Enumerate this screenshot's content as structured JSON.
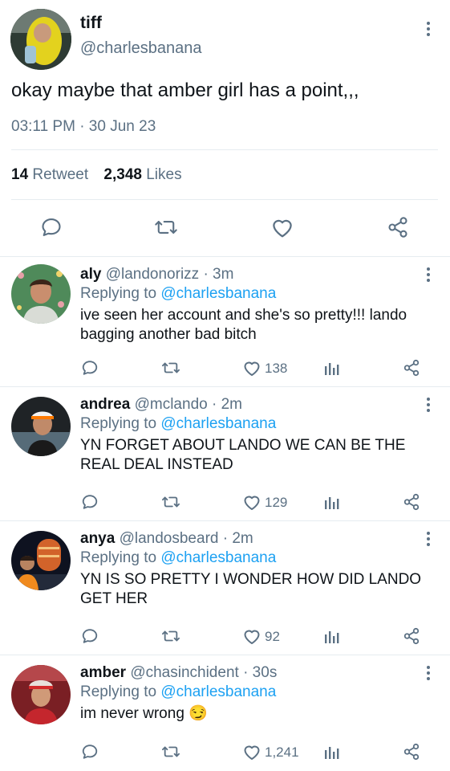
{
  "main_tweet": {
    "author_name": "tiff",
    "handle": "@charlesbanana",
    "text": "okay maybe that amber girl has a point,,,",
    "timestamp": "03:11 PM · 30 Jun 23",
    "retweet_count": "14",
    "retweet_label": "Retweet",
    "like_count": "2,348",
    "like_label": "Likes"
  },
  "replies": [
    {
      "name": "aly",
      "handle": "@landonorizz",
      "time": "· 3m",
      "replying_prefix": "Replying to",
      "replying_to": "@charlesbanana",
      "text": "ive seen her account and she's so pretty!!! lando bagging another bad bitch",
      "likes": "138"
    },
    {
      "name": "andrea",
      "handle": "@mclando",
      "time": "· 2m",
      "replying_prefix": "Replying to",
      "replying_to": "@charlesbanana",
      "text": "YN FORGET ABOUT LANDO WE CAN BE THE REAL DEAL INSTEAD",
      "likes": "129"
    },
    {
      "name": "anya",
      "handle": "@landosbeard",
      "time": "· 2m",
      "replying_prefix": "Replying to",
      "replying_to": "@charlesbanana",
      "text": "YN IS SO PRETTY I WONDER HOW DID LANDO GET HER",
      "likes": "92"
    },
    {
      "name": "amber",
      "handle": "@chasinchident",
      "time": "· 30s",
      "replying_prefix": "Replying to",
      "replying_to": "@charlesbanana",
      "text": "im never wrong 😏",
      "likes": "1,241"
    }
  ],
  "colors": {
    "link": "#1da1f2",
    "secondary_text": "#5b7083",
    "divider": "#e6ecf0"
  }
}
